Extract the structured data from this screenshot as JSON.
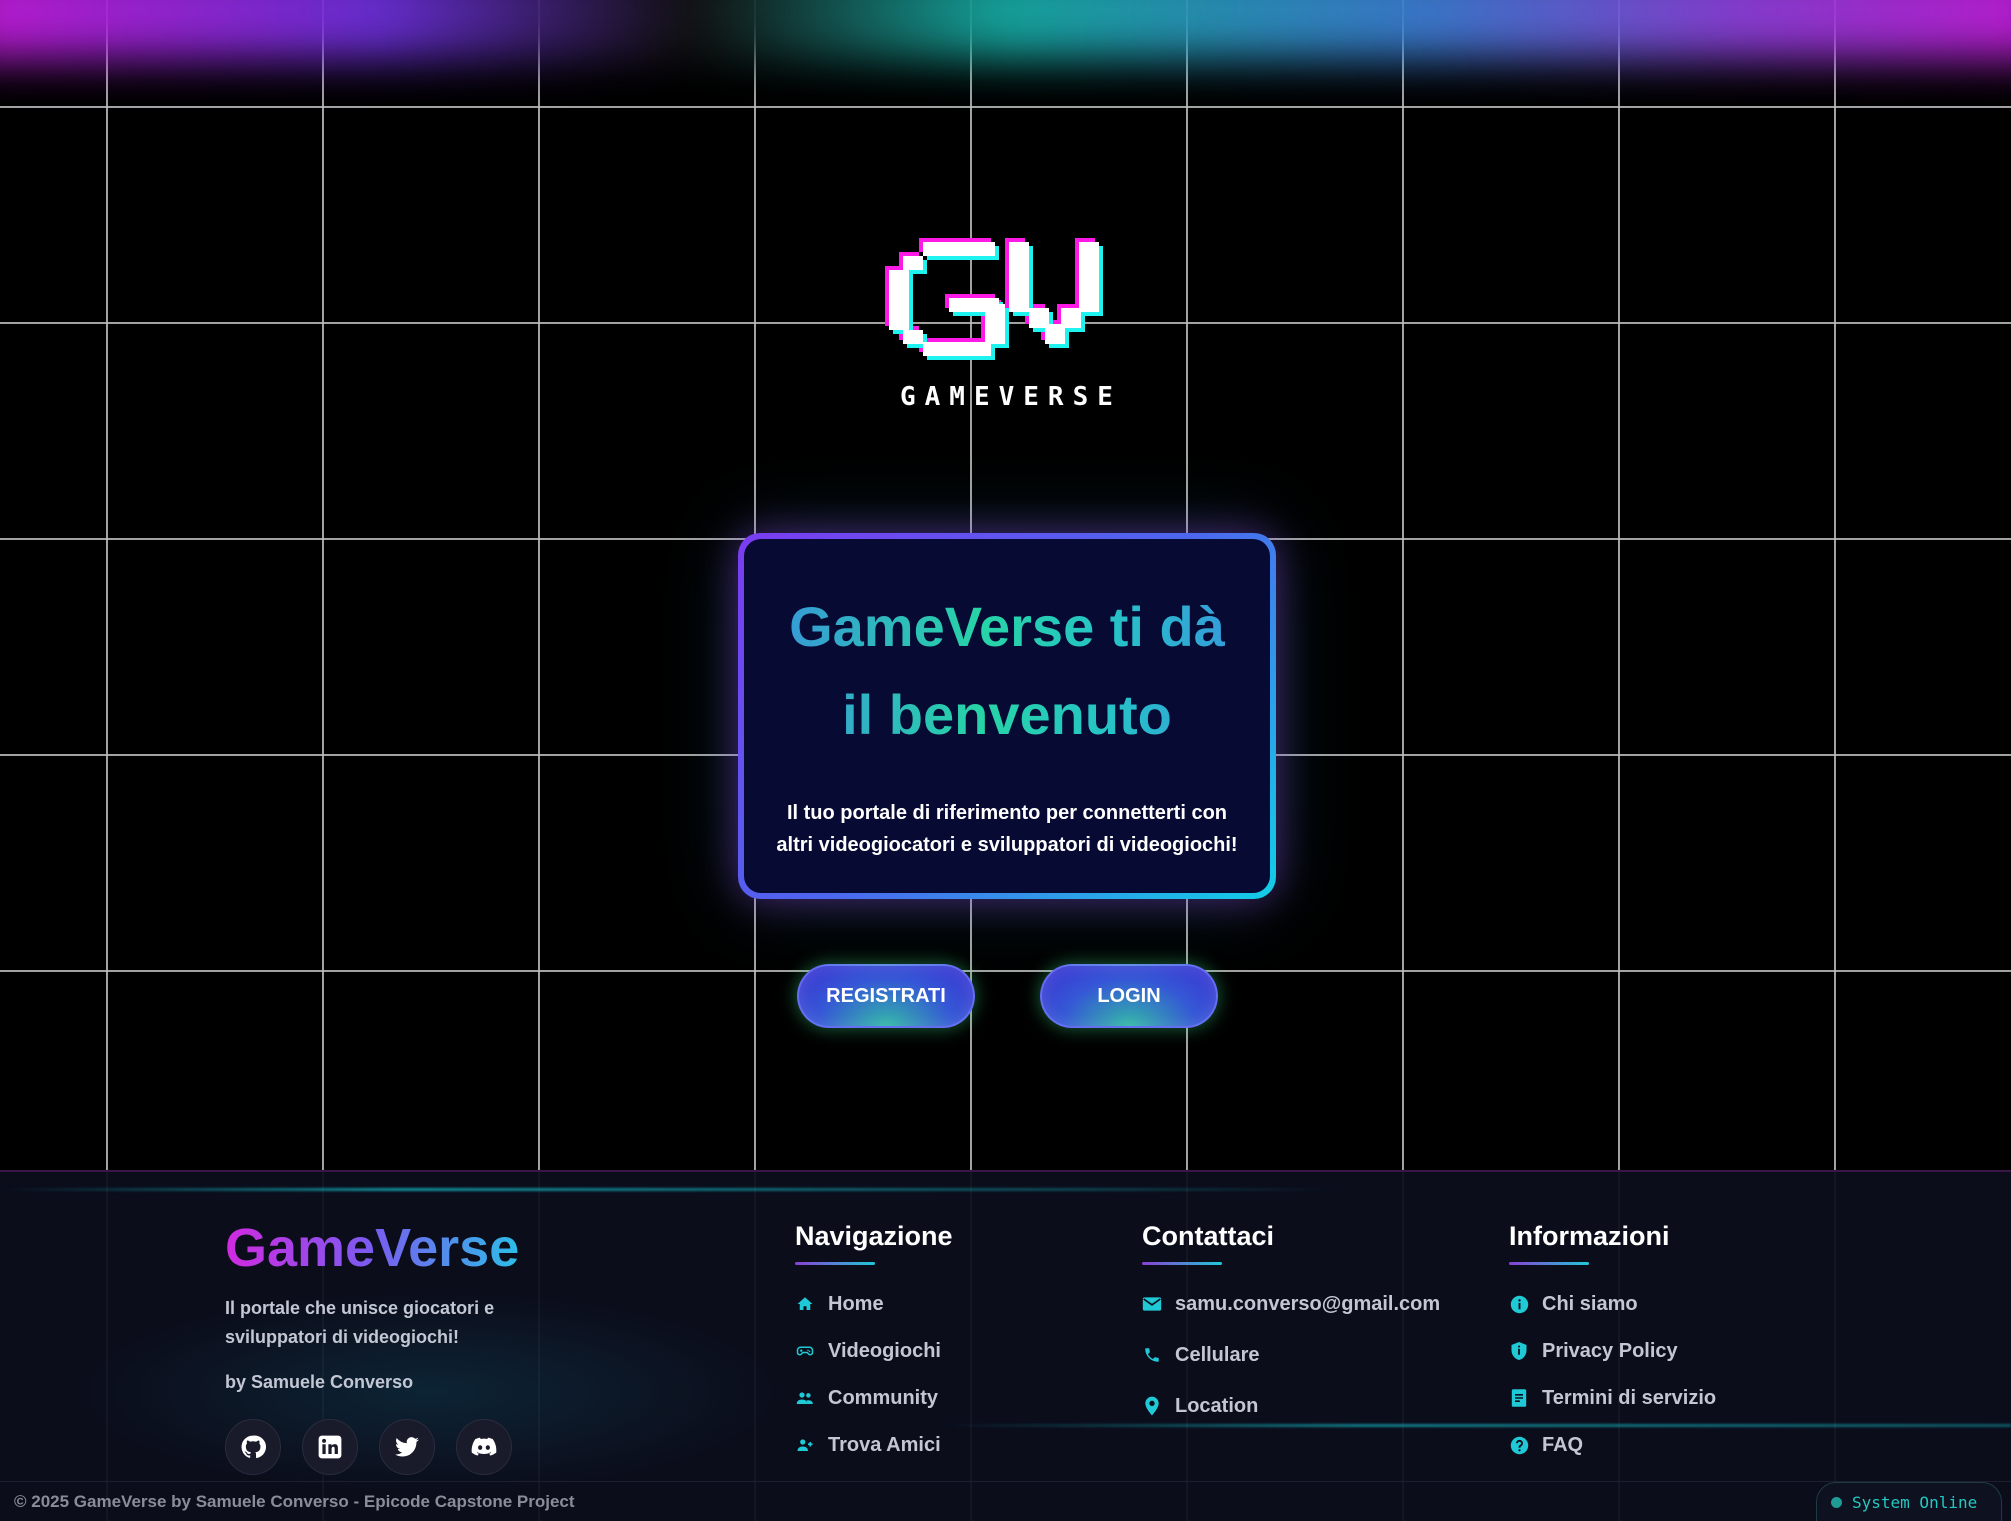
{
  "logo": {
    "wordmark": "GAMEVERSE"
  },
  "welcome": {
    "title_line1": "GameVerse ti dà",
    "title_line2": "il benvenuto",
    "subtitle_line1": "Il tuo portale di riferimento per connetterti con",
    "subtitle_line2": "altri videogiocatori e sviluppatori di videogiochi!"
  },
  "buttons": {
    "register": "REGISTRATI",
    "login": "LOGIN"
  },
  "footer": {
    "brand": "GameVerse",
    "description": "Il portale che unisce giocatori e sviluppatori di videogiochi!",
    "author": "by Samuele Converso",
    "socials": [
      {
        "icon": "github-icon"
      },
      {
        "icon": "linkedin-icon"
      },
      {
        "icon": "twitter-icon"
      },
      {
        "icon": "discord-icon"
      }
    ],
    "navigation": {
      "title": "Navigazione",
      "items": [
        {
          "label": "Home",
          "icon": "home-icon"
        },
        {
          "label": "Videogiochi",
          "icon": "gamepad-icon"
        },
        {
          "label": "Community",
          "icon": "users-icon"
        },
        {
          "label": "Trova Amici",
          "icon": "add-user-icon"
        }
      ]
    },
    "contact": {
      "title": "Contattaci",
      "items": [
        {
          "label": "samu.converso@gmail.com",
          "icon": "mail-icon"
        },
        {
          "label": "Cellulare",
          "icon": "phone-icon"
        },
        {
          "label": "Location",
          "icon": "location-pin-icon"
        }
      ]
    },
    "info": {
      "title": "Informazioni",
      "items": [
        {
          "label": "Chi siamo",
          "icon": "info-icon"
        },
        {
          "label": "Privacy Policy",
          "icon": "shield-icon"
        },
        {
          "label": "Termini di servizio",
          "icon": "document-icon"
        },
        {
          "label": "FAQ",
          "icon": "question-icon"
        }
      ]
    },
    "copyright": "© 2025 GameVerse by Samuele Converso - Epicode Capstone Project",
    "status": "System Online"
  },
  "colors": {
    "accent_teal": "#1fc9d6",
    "accent_purple": "#7b3cf0",
    "accent_magenta": "#d12ae0",
    "card_bg": "#070a33",
    "footer_bg": "#0b0d1b"
  }
}
